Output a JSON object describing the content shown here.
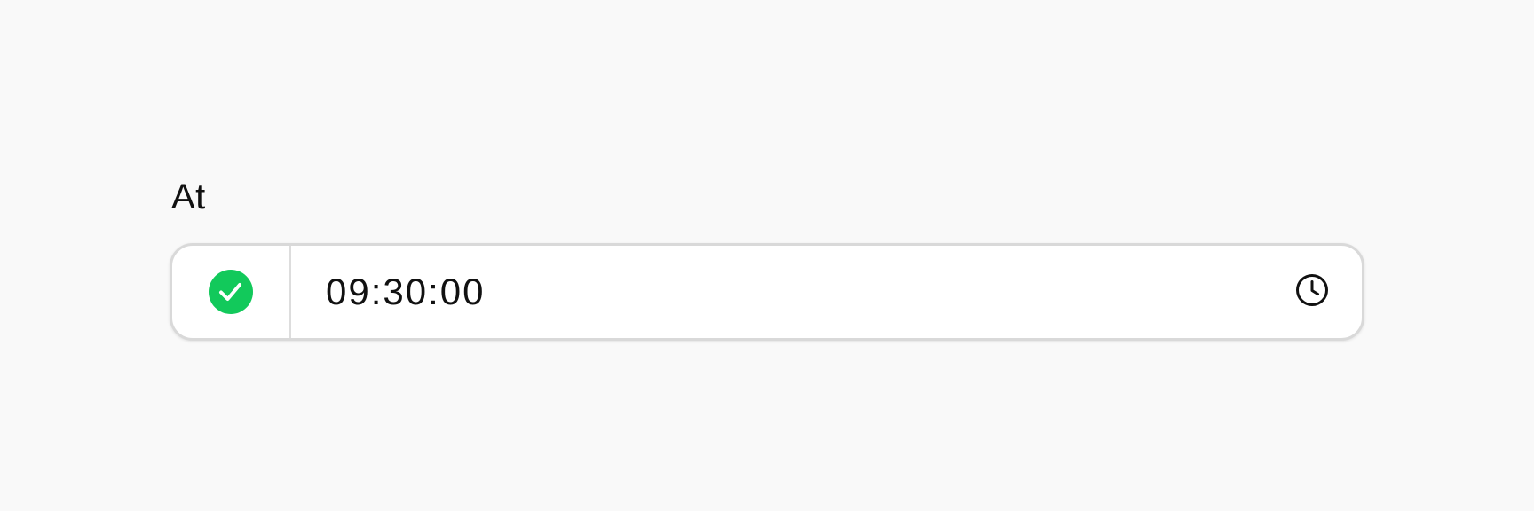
{
  "field": {
    "label": "At",
    "value": "09:30:00",
    "status": "valid",
    "status_icon": "check-circle-icon",
    "trailing_icon": "clock-icon"
  },
  "colors": {
    "status_valid": "#12c95b",
    "text": "#111111",
    "border": "#d9d9d9",
    "background": "#f9f9f9"
  }
}
